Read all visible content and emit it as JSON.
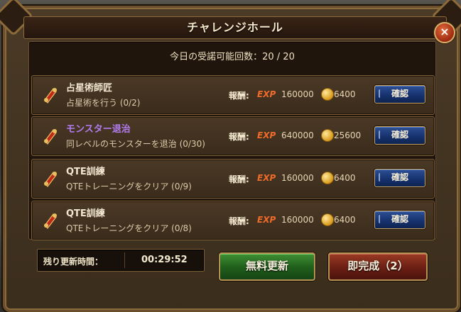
{
  "dialog": {
    "title": "チャレンジホール",
    "close_label": "×",
    "quota_text": "今日の受諾可能回数：20 / 20"
  },
  "quests": [
    {
      "title": "占星術師匠",
      "title_color": "#f1e6cf",
      "subtitle": "占星術を行う (0/2)",
      "reward_label": "報酬:",
      "exp_label": "EXP",
      "exp": "160000",
      "gold": "6400",
      "button": "確認"
    },
    {
      "title": "モンスター退治",
      "title_color": "#b27bf0",
      "subtitle": "同レベルのモンスターを退治 (0/30)",
      "reward_label": "報酬:",
      "exp_label": "EXP",
      "exp": "640000",
      "gold": "25600",
      "button": "確認"
    },
    {
      "title": "QTE訓練",
      "title_color": "#f1e6cf",
      "subtitle": "QTEトレーニングをクリア (0/9)",
      "reward_label": "報酬:",
      "exp_label": "EXP",
      "exp": "160000",
      "gold": "6400",
      "button": "確認"
    },
    {
      "title": "QTE訓練",
      "title_color": "#f1e6cf",
      "subtitle": "QTEトレーニングをクリア (0/8)",
      "reward_label": "報酬:",
      "exp_label": "EXP",
      "exp": "160000",
      "gold": "6400",
      "button": "確認"
    }
  ],
  "footer": {
    "timer_label": "残り更新時間：",
    "timer_value": "00:29:52",
    "free_refresh": "無料更新",
    "instant_complete": "即完成（2）"
  },
  "icons": {
    "quest_icon": "scroll-icon",
    "gold_icon": "gold-coin-icon",
    "close_icon": "close-icon"
  },
  "colors": {
    "exp": "#f06a2a",
    "highlight_title": "#b27bf0",
    "confirm_button": "#15306b",
    "refresh_button": "#1f5d1b",
    "complete_button": "#6b1f14"
  }
}
